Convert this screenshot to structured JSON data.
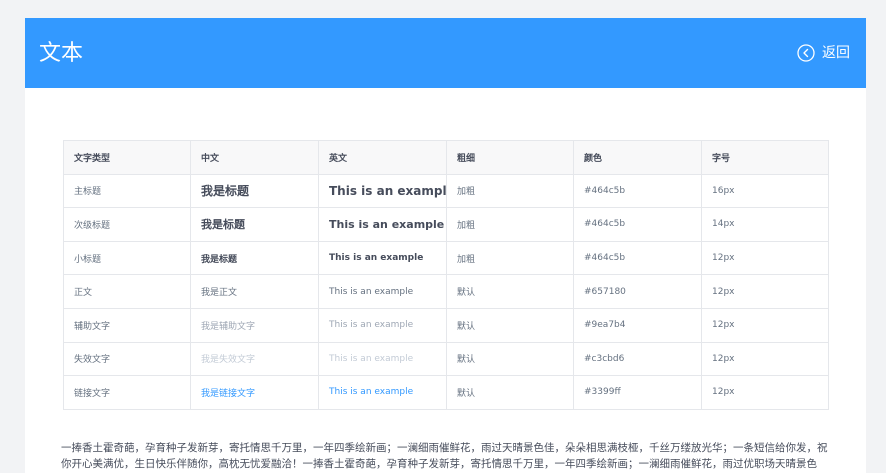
{
  "header": {
    "title": "文本",
    "back_label": "返回"
  },
  "table": {
    "columns": [
      "文字类型",
      "中文",
      "英文",
      "粗细",
      "颜色",
      "字号"
    ],
    "rows": [
      [
        "主标题",
        "我是标题",
        "This is an example",
        "加粗",
        "#464c5b",
        "16px"
      ],
      [
        "次级标题",
        "我是标题",
        "This is an example",
        "加粗",
        "#464c5b",
        "14px"
      ],
      [
        "小标题",
        "我是标题",
        "This is an example",
        "加粗",
        "#464c5b",
        "12px"
      ],
      [
        "正文",
        "我是正文",
        "This is an example",
        "默认",
        "#657180",
        "12px"
      ],
      [
        "辅助文字",
        "我是辅助文字",
        "This is an example",
        "默认",
        "#9ea7b4",
        "12px"
      ],
      [
        "失效文字",
        "我是失效文字",
        "This is an example",
        "默认",
        "#c3cbd6",
        "12px"
      ],
      [
        "链接文字",
        "我是链接文字",
        "This is an example",
        "默认",
        "#3399ff",
        "12px"
      ]
    ]
  },
  "paragraph": "一捧香土霍奇葩，孕育种子发新芽，寄托情思千万里，一年四季绘新画；一澜细雨催鲜花，雨过天晴景色佳，朵朵相思满枝桠，千丝万缕放光华；一条短信给你发，祝你开心美满优，生日快乐伴随你，高枕无忧爱融洽！一捧香土霍奇葩，孕育种子发新芽，寄托情思千万里，一年四季绘新画；一澜细雨催鲜花，雨过优职场天晴景色佳，朵朵相思满枝桠，千丝万缕放光华，一条短信给你发，祝你开心美满优，生日快乐伴随你，高枕无忧爱融洽！",
  "colors": {
    "accent": "#3399ff",
    "title": "#464c5b",
    "body": "#657180",
    "hint": "#9ea7b4",
    "disabled": "#c3cbd6",
    "link": "#3399ff"
  },
  "icons": {
    "back": "chevron-left-circle-icon"
  }
}
